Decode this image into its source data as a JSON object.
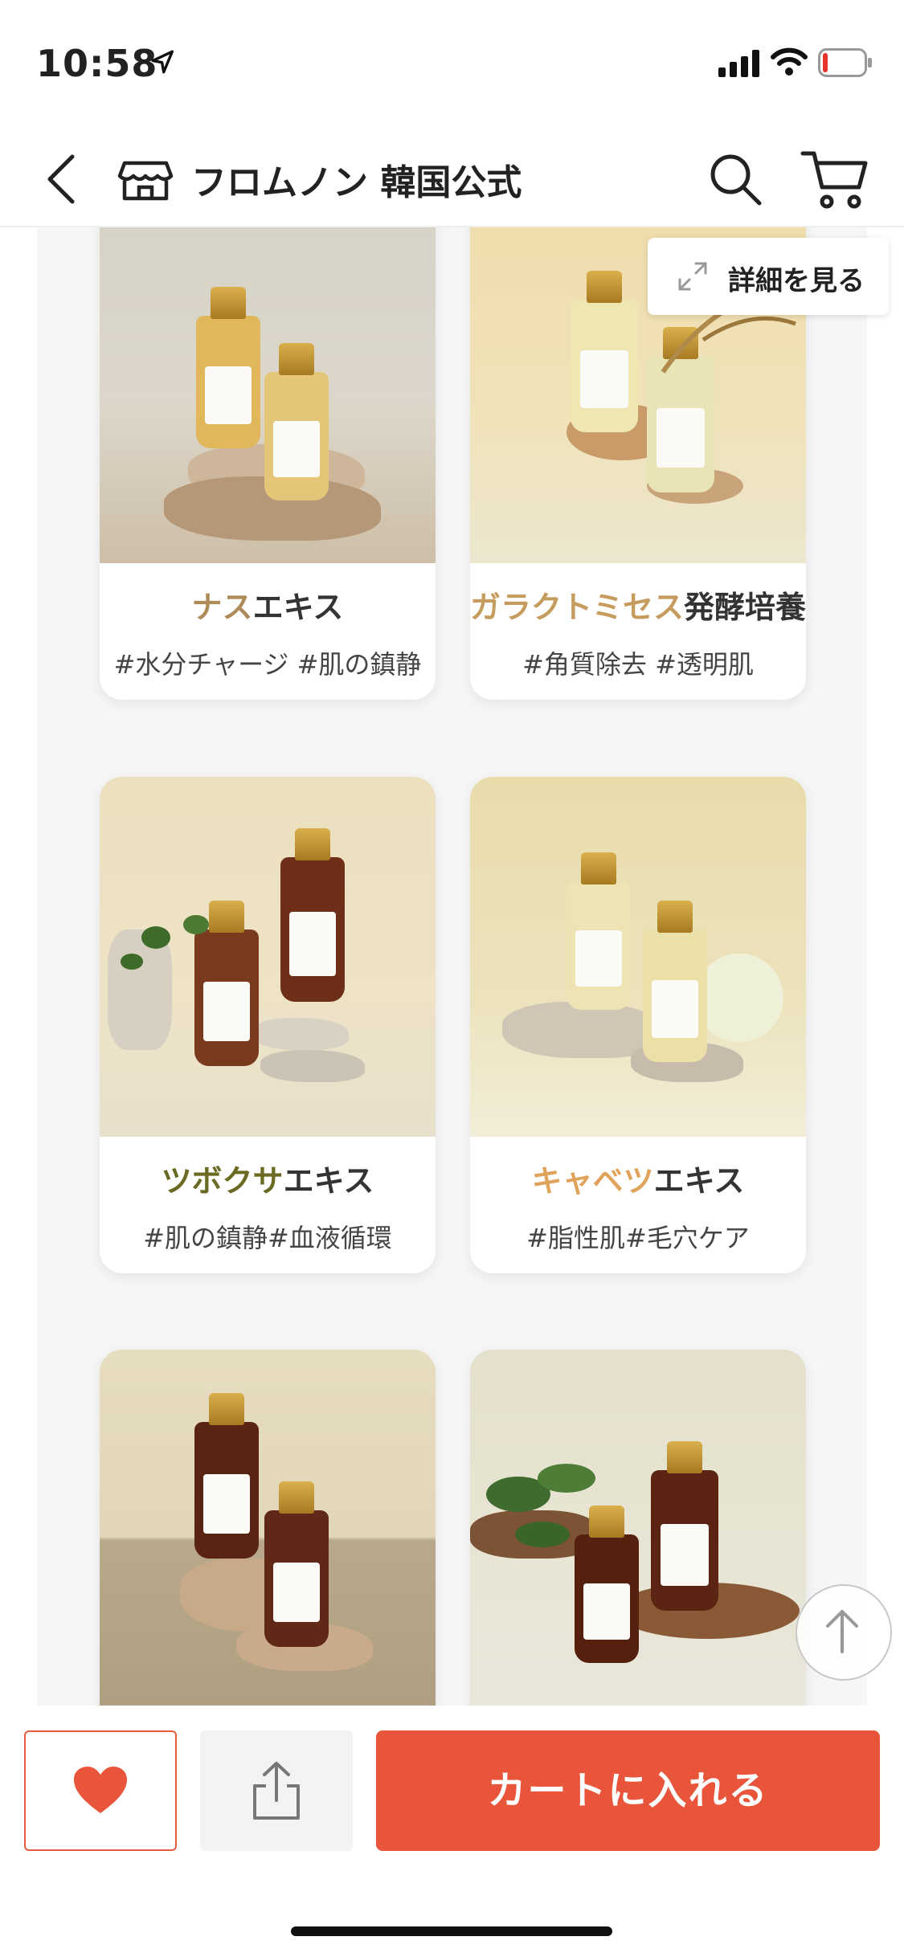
{
  "status": {
    "time": "10:58"
  },
  "header": {
    "shop_name": "フロムノン 韓国公式"
  },
  "detail_button": {
    "label": "詳細を見る"
  },
  "products": [
    {
      "name_accent": "ナス",
      "name_rest": "エキス",
      "accent_color": "#b08b5a",
      "tags": "#水分チャージ #肌の鎮静"
    },
    {
      "name_accent": "ガラクトミセス",
      "name_rest": "発酵培養液",
      "accent_color": "#c59b5e",
      "tags": "#角質除去 #透明肌"
    },
    {
      "name_accent": "ツボクサ",
      "name_rest": "エキス",
      "accent_color": "#6a6a22",
      "tags": "#肌の鎮静#血液循環"
    },
    {
      "name_accent": "キャベツ",
      "name_rest": "エキス",
      "accent_color": "#e0a35c",
      "tags": "#脂性肌#毛穴ケア"
    },
    {
      "name_accent": "",
      "name_rest": "",
      "accent_color": "#333333",
      "tags": ""
    },
    {
      "name_accent": "",
      "name_rest": "",
      "accent_color": "#333333",
      "tags": ""
    }
  ],
  "bottom_bar": {
    "cart_label": "カートに入れる"
  },
  "colors": {
    "primary": "#e9553a",
    "panel_bg": "#f6f6f6"
  }
}
